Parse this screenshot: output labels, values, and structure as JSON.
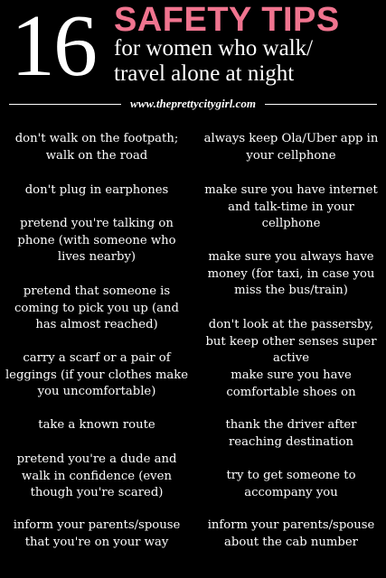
{
  "header": {
    "number": "16",
    "title": "SAFETY TIPS",
    "subtitle_line1": "for women who walk/",
    "subtitle_line2": "travel alone at night",
    "url": "www.theprettycitygirl.com"
  },
  "colors": {
    "background": "#000000",
    "accent": "#f0748f",
    "text": "#ffffff"
  },
  "tips_left": [
    "don't walk on the footpath; walk on the road",
    "don't plug in earphones",
    "pretend you're talking on phone (with someone who lives nearby)",
    "pretend that someone is coming to pick you up (and has almost reached)",
    "carry a scarf or a pair of leggings (if your clothes make you uncomfortable)",
    "take a known route",
    "pretend you're a dude and walk in confidence (even though you're scared)",
    "inform your parents/spouse that you're on your way"
  ],
  "tips_right": [
    "always keep Ola/Uber app in your cellphone",
    "make sure you have internet and talk-time in your cellphone",
    "make sure you always have money (for taxi, in case you miss the bus/train)",
    "don't look at the passersby, but keep other senses super active",
    "make sure you have comfortable shoes on",
    "thank the driver after reaching destination",
    "try to get someone to accompany you",
    "inform your parents/spouse about the cab number"
  ]
}
